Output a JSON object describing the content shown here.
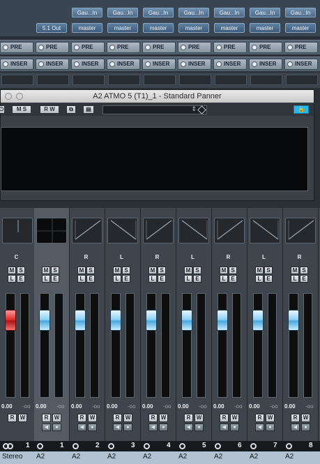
{
  "routing": {
    "inputs": [
      "Gau...In",
      "Gau...In",
      "Gau...In",
      "Gau...In",
      "Gau...In",
      "Gau...In",
      "Gau...In"
    ],
    "outputs": [
      "5.1 Out",
      "master",
      "master",
      "master",
      "master",
      "master",
      "master",
      "master"
    ]
  },
  "pre_label": "PRE",
  "insert_label": "INSER",
  "panner_window": {
    "title": "A2 ATMO 5 (T1)_1 - Standard Panner",
    "toolbar": {
      "ms": "M S",
      "rw": "R W"
    }
  },
  "strips": [
    {
      "pan": "C",
      "vol": "0.00",
      "peak": "-oo",
      "num": "1",
      "name": "Stereo"
    },
    {
      "pan": "",
      "vol": "0.00",
      "peak": "-oo",
      "num": "1",
      "name": "A2"
    },
    {
      "pan": "R",
      "vol": "0.00",
      "peak": "-oo",
      "num": "2",
      "name": "A2"
    },
    {
      "pan": "L",
      "vol": "0.00",
      "peak": "-oo",
      "num": "3",
      "name": "A2"
    },
    {
      "pan": "R",
      "vol": "0.00",
      "peak": "-oo",
      "num": "4",
      "name": "A2"
    },
    {
      "pan": "L",
      "vol": "0.00",
      "peak": "-oo",
      "num": "5",
      "name": "A2"
    },
    {
      "pan": "R",
      "vol": "0.00",
      "peak": "-oo",
      "num": "6",
      "name": "A2"
    },
    {
      "pan": "L",
      "vol": "0.00",
      "peak": "-oo",
      "num": "7",
      "name": "A2"
    },
    {
      "pan": "R",
      "vol": "0.00",
      "peak": "-oo",
      "num": "8",
      "name": "A2"
    }
  ],
  "buttons": {
    "m": "M",
    "s": "S",
    "l": "L",
    "e": "E",
    "r": "R",
    "w": "W"
  },
  "colors": {
    "fader_cap": "#8ed2f5",
    "fader_cap_master": "#e53030",
    "lock_active": "#2bb8e8"
  }
}
